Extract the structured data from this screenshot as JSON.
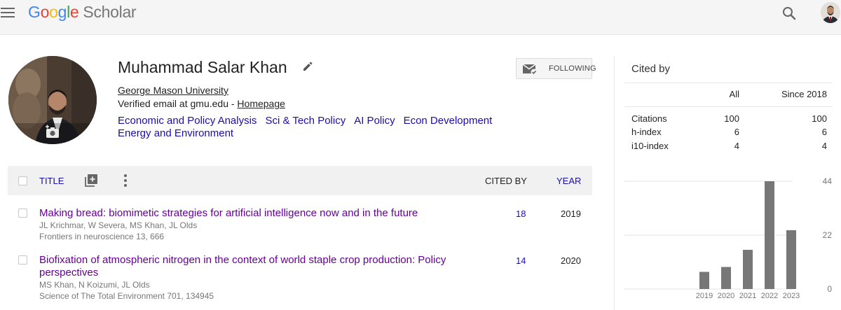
{
  "header": {
    "logo_letters": [
      "G",
      "o",
      "o",
      "g",
      "l",
      "e"
    ],
    "logo_suffix": "Scholar"
  },
  "profile": {
    "name": "Muhammad Salar Khan",
    "affiliation": "George Mason University",
    "verified_text": "Verified email at gmu.edu - ",
    "homepage_label": "Homepage",
    "interests": [
      "Economic and Policy Analysis",
      "Sci & Tech Policy",
      "AI Policy",
      "Econ Development",
      "Energy and Environment"
    ],
    "follow_label": "FOLLOWING"
  },
  "table": {
    "title_header": "TITLE",
    "cited_header": "CITED BY",
    "year_header": "YEAR",
    "articles": [
      {
        "title": "Making bread: biomimetic strategies for artificial intelligence now and in the future",
        "authors": "JL Krichmar, W Severa, MS Khan, JL Olds",
        "venue": "Frontiers in neuroscience 13, 666",
        "cited_by": "18",
        "year": "2019"
      },
      {
        "title": "Biofixation of atmospheric nitrogen in the context of world staple crop production: Policy perspectives",
        "authors": "MS Khan, N Koizumi, JL Olds",
        "venue": "Science of The Total Environment 701, 134945",
        "cited_by": "14",
        "year": "2020"
      }
    ]
  },
  "cited_by": {
    "title": "Cited by",
    "col_all": "All",
    "col_since": "Since 2018",
    "rows": [
      {
        "label": "Citations",
        "all": "100",
        "since": "100"
      },
      {
        "label": "h-index",
        "all": "6",
        "since": "6"
      },
      {
        "label": "i10-index",
        "all": "4",
        "since": "4"
      }
    ]
  },
  "chart_data": {
    "type": "bar",
    "categories": [
      "2019",
      "2020",
      "2021",
      "2022",
      "2023"
    ],
    "values": [
      7,
      9,
      16,
      44,
      24
    ],
    "yticks": [
      "0",
      "22",
      "44"
    ],
    "ylim": [
      0,
      44
    ],
    "bar_color": "#777777",
    "grid": true
  },
  "colors": {
    "link": "#1a0dab",
    "visited": "#660099",
    "google_blue": "#4285f4",
    "google_red": "#ea4335",
    "google_yellow": "#fbbc05",
    "google_green": "#34a853"
  },
  "icons": {
    "menu": "hamburger-menu-icon",
    "search": "search-icon",
    "edit": "pencil-icon",
    "follow": "mail-check-icon",
    "camera": "add-photo-icon",
    "add": "add-box-icon",
    "more": "more-vert-icon"
  }
}
